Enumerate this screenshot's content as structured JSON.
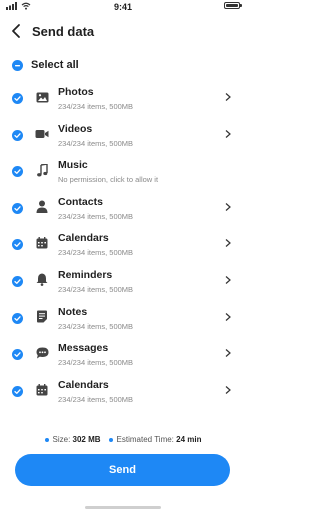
{
  "status": {
    "time": "9:41"
  },
  "header": {
    "title": "Send data"
  },
  "select_all": {
    "label": "Select all",
    "checked": true
  },
  "items": [
    {
      "title": "Photos",
      "subtitle": "234/234 items, 500MB",
      "icon": "image-icon"
    },
    {
      "title": "Videos",
      "subtitle": "234/234 items, 500MB",
      "icon": "video-icon"
    },
    {
      "title": "Music",
      "subtitle": "No permission, click to allow it",
      "icon": "music-icon"
    },
    {
      "title": "Contacts",
      "subtitle": "234/234 items, 500MB",
      "icon": "person-icon"
    },
    {
      "title": "Calendars",
      "subtitle": "234/234 items, 500MB",
      "icon": "calendar-icon"
    },
    {
      "title": "Reminders",
      "subtitle": "234/234 items, 500MB",
      "icon": "bell-icon"
    },
    {
      "title": "Notes",
      "subtitle": "234/234 items, 500MB",
      "icon": "note-icon"
    },
    {
      "title": "Messages",
      "subtitle": "234/234 items, 500MB",
      "icon": "message-icon"
    },
    {
      "title": "Calendars",
      "subtitle": "234/234 items, 500MB",
      "icon": "calendar-icon"
    }
  ],
  "footer": {
    "size_label": "Size:",
    "size_value": "302 MB",
    "time_label": "Estimated Time:",
    "time_value": "24 min"
  },
  "send_button": {
    "label": "Send"
  },
  "colors": {
    "accent": "#1e88f5"
  }
}
